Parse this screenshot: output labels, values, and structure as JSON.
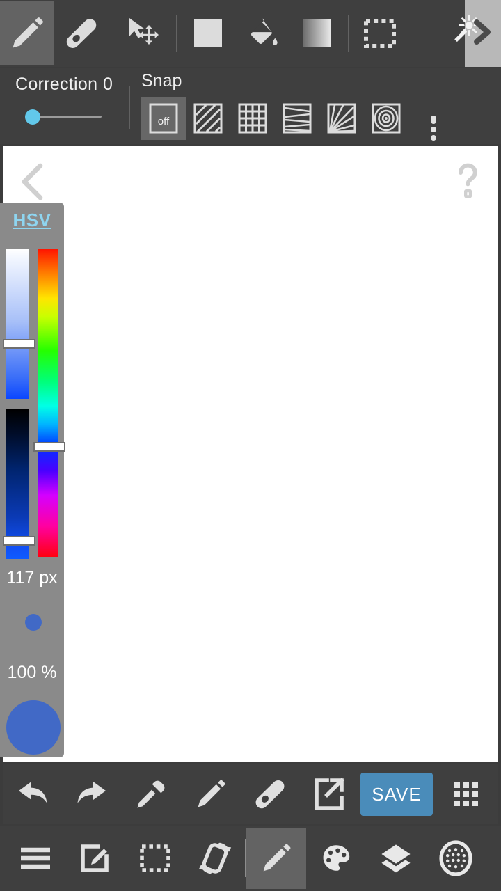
{
  "app": {
    "name": "sketch-drawing-app",
    "accent_blue": "#4a8cba",
    "brush_color": "#4169c6",
    "slider_accent": "#62c8ea",
    "panel_gray": "#8a8a8a",
    "bar_gray": "#3f3f3f"
  },
  "toolbar_top": {
    "tools": [
      {
        "name": "pencil-tool",
        "icon": "pencil-icon",
        "selected": true
      },
      {
        "name": "eraser-tool",
        "icon": "eraser-icon",
        "selected": false
      },
      {
        "name": "move-tool",
        "icon": "cursor-move-icon",
        "selected": false
      },
      {
        "name": "shape-tool",
        "icon": "filled-square-icon",
        "selected": false
      },
      {
        "name": "fill-tool",
        "icon": "paint-bucket-icon",
        "selected": false
      },
      {
        "name": "gradient-tool",
        "icon": "gradient-square-icon",
        "selected": false
      },
      {
        "name": "select-tool",
        "icon": "dashed-rectangle-icon",
        "selected": false
      }
    ],
    "overflow": {
      "name": "magic-wand-more",
      "icon": "magic-wand-icon",
      "chevron": "chevron-right-icon"
    }
  },
  "correction": {
    "label": "Correction",
    "value": "0",
    "slider_percent": 0
  },
  "snap": {
    "label": "Snap",
    "options": [
      {
        "name": "snap-off",
        "label": "off",
        "icon": "snap-off-icon",
        "selected": true
      },
      {
        "name": "snap-parallel",
        "label": "",
        "icon": "snap-diagonal-stripes-icon",
        "selected": false
      },
      {
        "name": "snap-grid",
        "label": "",
        "icon": "snap-grid-icon",
        "selected": false
      },
      {
        "name": "snap-converge",
        "label": "",
        "icon": "snap-converging-lines-icon",
        "selected": false
      },
      {
        "name": "snap-radial",
        "label": "",
        "icon": "snap-radial-burst-icon",
        "selected": false
      },
      {
        "name": "snap-concentric",
        "label": "",
        "icon": "snap-concentric-circles-icon",
        "selected": false
      }
    ],
    "more": {
      "name": "snap-overflow-menu",
      "icon": "three-dots-vertical-icon"
    }
  },
  "canvas": {
    "back": {
      "name": "back-chevron",
      "icon": "chevron-left-icon"
    },
    "help": {
      "name": "help-button",
      "icon": "question-mark-icon"
    },
    "background": "#ffffff"
  },
  "color_panel": {
    "mode_label": "HSV",
    "saturation_handle_percent": 62,
    "value_handle_percent": 88,
    "hue_handle_percent": 63,
    "brush_size": "117 px",
    "opacity": "100 %",
    "preview_color": "#4169c6"
  },
  "action_bar": {
    "buttons": [
      {
        "name": "undo-button",
        "icon": "undo-arrow-icon",
        "label": ""
      },
      {
        "name": "redo-button",
        "icon": "redo-arrow-icon",
        "label": ""
      },
      {
        "name": "eyedropper-button",
        "icon": "eyedropper-icon",
        "label": ""
      },
      {
        "name": "pencil-button",
        "icon": "pencil-icon",
        "label": ""
      },
      {
        "name": "eraser-button",
        "icon": "eraser-icon",
        "label": ""
      },
      {
        "name": "export-button",
        "icon": "external-link-icon",
        "label": ""
      }
    ],
    "save": {
      "name": "save-button",
      "label": "SAVE"
    },
    "apps": {
      "name": "apps-grid-button",
      "icon": "grid-dots-icon"
    }
  },
  "bottom_nav": {
    "items": [
      {
        "name": "nav-menu",
        "icon": "hamburger-menu-icon",
        "active": false
      },
      {
        "name": "nav-edit",
        "icon": "compose-edit-icon",
        "active": false
      },
      {
        "name": "nav-select",
        "icon": "dashed-rectangle-icon",
        "active": false
      },
      {
        "name": "nav-rotate",
        "icon": "rotate-device-icon",
        "active": false
      },
      {
        "name": "nav-draw",
        "icon": "pencil-icon",
        "active": true
      },
      {
        "name": "nav-palette",
        "icon": "palette-icon",
        "active": false
      },
      {
        "name": "nav-layers",
        "icon": "layers-icon",
        "active": false
      },
      {
        "name": "nav-texture",
        "icon": "dotted-oval-brush-icon",
        "active": false
      }
    ]
  }
}
